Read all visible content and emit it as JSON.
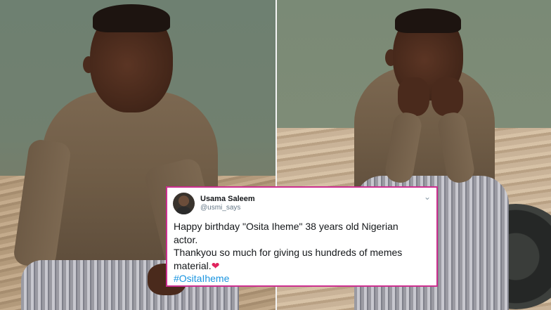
{
  "tweet": {
    "display_name": "Usama Saleem",
    "handle": "@usmi_says",
    "line1": "Happy birthday \"Osita Iheme\" 38 years old Nigerian",
    "line2": "actor.",
    "line3": "Thankyou so much for giving us hundreds of memes",
    "line4": "material.",
    "heart": "❤",
    "hashtag": "#OsitaIheme",
    "menu_glyph": "⌄"
  },
  "colors": {
    "card_border": "#cc2f8f",
    "hashtag": "#1b95e0",
    "heart": "#e0245e"
  },
  "icons": [
    "avatar",
    "chevron-down-icon",
    "heart-icon"
  ]
}
